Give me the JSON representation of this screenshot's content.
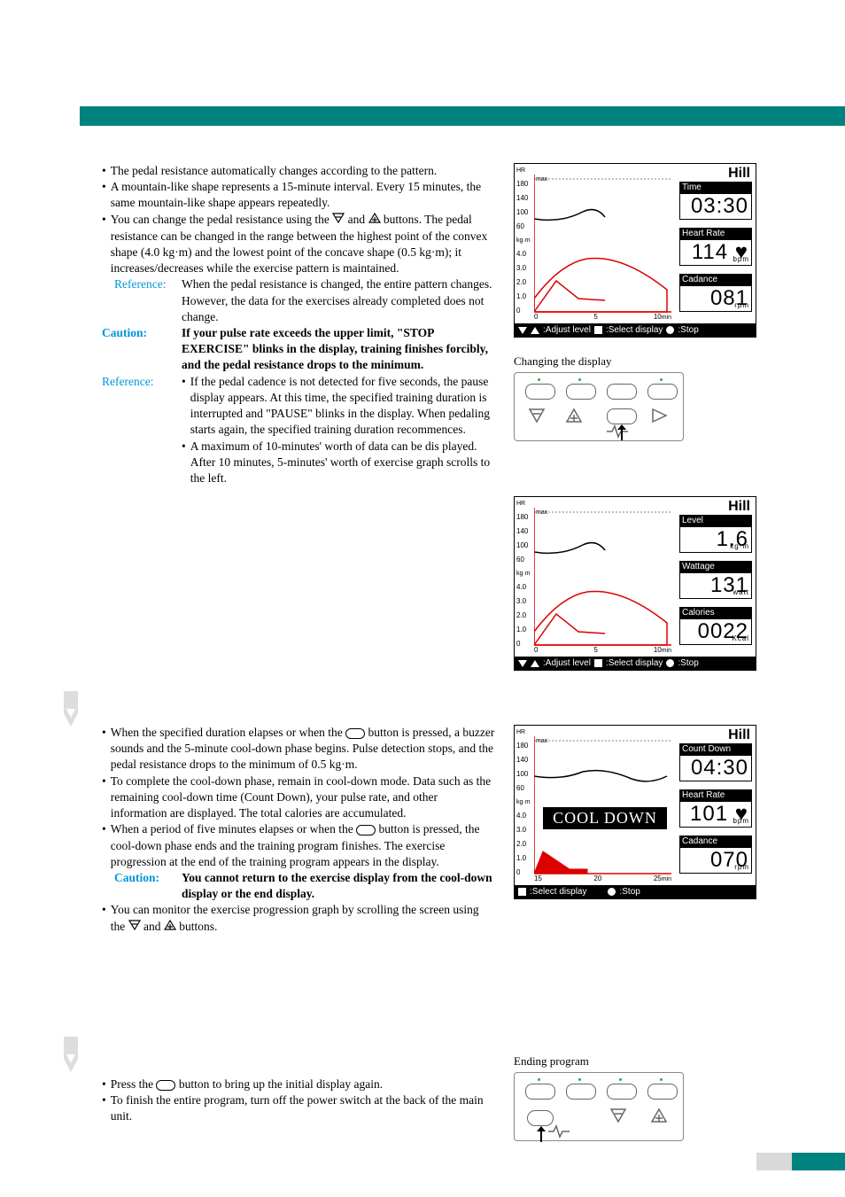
{
  "section1": {
    "b1": "The pedal resistance automatically changes according to the pattern.",
    "b2": "A mountain-like shape represents a 15-minute interval. Every 15 minutes, the same mountain-like shape appears repeatedly.",
    "b3a": "You can change the pedal resistance using the ",
    "b3b": " and ",
    "b3c": " buttons. The pedal resistance can be changed in the range between the highest point of the convex shape (4.0 kg·m) and the lowest point of the concave shape (0.5 kg·m); it increases/decreases while the exercise pattern is maintained.",
    "ref1_label": "Reference:",
    "ref1_body": "When the pedal resistance is changed, the entire pattern changes. However, the data for the exercises already completed does not change.",
    "caution1_label": "Caution:",
    "caution1_body": "If your pulse rate exceeds the upper limit, \"STOP EXERCISE\" blinks in the display, training finishes forcibly, and the pedal resistance drops to the minimum.",
    "ref2_label": "Reference:",
    "ref2_b1": "If the pedal cadence is not detected for five seconds, the pause display appears. At this time, the specified training duration is interrupted and \"PAUSE\" blinks in the display. When pedaling starts again, the specified training duration recommences.",
    "ref2_b2": "A maximum of 10-minutes' worth of data can be dis played. After 10 minutes, 5-minutes' worth of exercise graph scrolls to the left."
  },
  "section2": {
    "b1a": "When the specified duration elapses or when the ",
    "b1b": " button is pressed, a buzzer sounds and the 5-minute cool-down phase begins. Pulse detection stops, and the pedal resistance drops to the minimum of 0.5 kg·m.",
    "b2": "To complete the cool-down phase, remain in cool-down mode. Data such as the remaining cool-down time (Count Down), your pulse rate, and other information are displayed. The total calories are accumulated.",
    "b3a": "When a period of five minutes elapses or when the ",
    "b3b": " button is pressed, the cool-down phase ends and the training program finishes. The exercise progression at the end of the training program appears in the display.",
    "caution_label": "Caution:",
    "caution_body": "You cannot return to the exercise display from the cool-down display or the end display.",
    "b4a": "You can monitor the exercise progression graph by scrolling the screen using the ",
    "b4b": " and ",
    "b4c": " buttons."
  },
  "section3": {
    "b1a": "Press the ",
    "b1b": " button to bring up the initial display again.",
    "b2": "To finish the entire program, turn off the power switch at the back of the main unit."
  },
  "caption1": "Changing the display",
  "caption2": "Ending program",
  "display1": {
    "mode": "Hill",
    "hr_label": "HR",
    "max_label": "max",
    "y_hr": [
      "180",
      "140",
      "100",
      "60"
    ],
    "y_kgm_label": "kg·m",
    "y_kgm": [
      "4.0",
      "3.0",
      "2.0",
      "1.0",
      "0"
    ],
    "x_ticks": [
      "0",
      "5",
      "10"
    ],
    "x_unit": "min",
    "stat1_label": "Time",
    "stat1_value": "03:30",
    "stat2_label": "Heart Rate",
    "stat2_value": "114",
    "stat2_unit": "bpm",
    "stat3_label": "Cadance",
    "stat3_value": "081",
    "stat3_unit": "rpm",
    "status_adjust": ":Adjust level",
    "status_select": ":Select display",
    "status_stop": ":Stop"
  },
  "display2": {
    "mode": "Hill",
    "hr_label": "HR",
    "max_label": "max",
    "y_hr": [
      "180",
      "140",
      "100",
      "60"
    ],
    "y_kgm_label": "kg·m",
    "y_kgm": [
      "4.0",
      "3.0",
      "2.0",
      "1.0",
      "0"
    ],
    "x_ticks": [
      "0",
      "5",
      "10"
    ],
    "x_unit": "min",
    "stat1_label": "Level",
    "stat1_value": "1.6",
    "stat1_unit": "kg·m",
    "stat2_label": "Wattage",
    "stat2_value": "131",
    "stat2_unit": "watt",
    "stat3_label": "Calories",
    "stat3_value": "0022",
    "stat3_unit": "Kcal",
    "status_adjust": ":Adjust level",
    "status_select": ":Select display",
    "status_stop": ":Stop"
  },
  "display3": {
    "mode": "Hill",
    "hr_label": "HR",
    "max_label": "max",
    "y_hr": [
      "180",
      "140",
      "100",
      "60"
    ],
    "y_kgm_label": "kg·m",
    "y_kgm": [
      "4.0",
      "3.0",
      "2.0",
      "1.0",
      "0"
    ],
    "x_ticks": [
      "15",
      "20",
      "25"
    ],
    "x_unit": "min",
    "overlay": "COOL DOWN",
    "stat1_label": "Count Down",
    "stat1_value": "04:30",
    "stat2_label": "Heart Rate",
    "stat2_value": "101",
    "stat2_unit": "bpm",
    "stat3_label": "Cadance",
    "stat3_value": "070",
    "stat3_unit": "rpm",
    "status_select": ":Select display",
    "status_stop": ":Stop"
  }
}
